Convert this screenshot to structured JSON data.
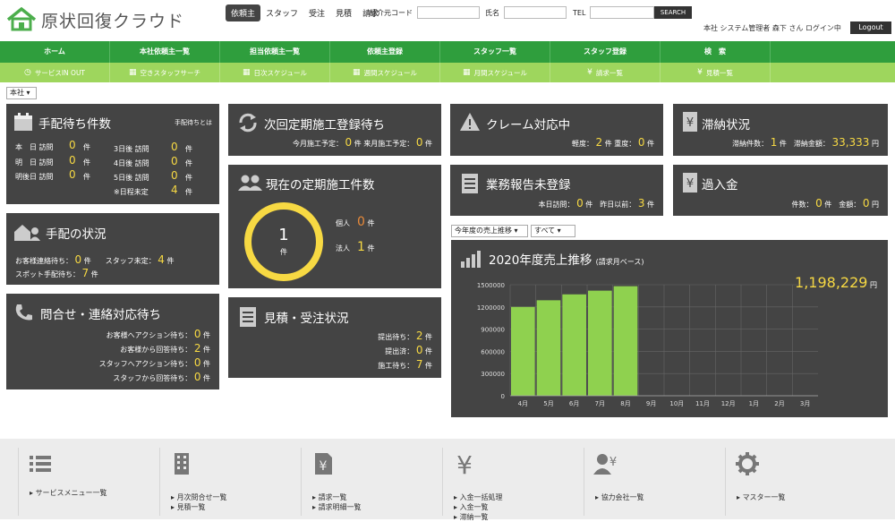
{
  "header": {
    "logo_text": "原状回復クラウド",
    "tabs": [
      "依頼主",
      "スタッフ",
      "受注",
      "見積",
      "請求"
    ],
    "search_labels": {
      "code": "紹介元コード",
      "name": "氏名",
      "tel": "TEL"
    },
    "search_button": "SEARCH",
    "user_info": "本社 システム管理者 森下 さん ログイン中",
    "logout": "Logout"
  },
  "nav_main": [
    "ホーム",
    "本社依頼主一覧",
    "担当依頼主一覧",
    "依頼主登録",
    "スタッフ一覧",
    "スタッフ登録",
    "検　索"
  ],
  "nav_sub": [
    {
      "label": "サービスIN OUT",
      "icon": "clock-icon"
    },
    {
      "label": "空きスタッフサーチ",
      "icon": "calendar-icon"
    },
    {
      "label": "日次スケジュール",
      "icon": "calendar-icon"
    },
    {
      "label": "週間スケジュール",
      "icon": "calendar-icon"
    },
    {
      "label": "月間スケジュール",
      "icon": "calendar-icon"
    },
    {
      "label": "請求一覧",
      "icon": "yen-icon"
    },
    {
      "label": "見積一覧",
      "icon": "yen-icon"
    }
  ],
  "branch_select": "本社",
  "tehai_wait": {
    "title": "手配待ち件数",
    "link": "手配待ちとは",
    "rows": [
      {
        "label": "本　日 訪問",
        "value": "0",
        "unit": "件"
      },
      {
        "label": "明　日 訪問",
        "value": "0",
        "unit": "件"
      },
      {
        "label": "明後日 訪問",
        "value": "0",
        "unit": "件"
      },
      {
        "label": "3日後 訪問",
        "value": "0",
        "unit": "件"
      },
      {
        "label": "4日後 訪問",
        "value": "0",
        "unit": "件"
      },
      {
        "label": "5日後 訪問",
        "value": "0",
        "unit": "件"
      },
      {
        "label": "※日程未定",
        "value": "4",
        "unit": "件"
      }
    ]
  },
  "tehai_status": {
    "title": "手配の状況",
    "l1": "お客様連絡待ち：",
    "v1": "0",
    "l2": "スタッフ未定：",
    "v2": "4",
    "l3": "スポット手配待ち：",
    "v3": "7",
    "unit": "件"
  },
  "inquiry": {
    "title": "問合せ・連絡対応待ち",
    "rows": [
      {
        "label": "お客様へアクション待ち：",
        "value": "0"
      },
      {
        "label": "お客様から回答待ち：",
        "value": "2"
      },
      {
        "label": "スタッフへアクション待ち：",
        "value": "0"
      },
      {
        "label": "スタッフから回答待ち：",
        "value": "0"
      }
    ],
    "unit": "件"
  },
  "next_reg": {
    "title": "次回定期施工登録待ち",
    "l1": "今月施工予定：",
    "v1": "0",
    "l2": "件 来月施工予定：",
    "v2": "0",
    "unit": "件"
  },
  "regular": {
    "title": "現在の定期施工件数",
    "total": "1",
    "total_unit": "件",
    "personal_label": "個人",
    "personal": "0",
    "corp_label": "法人",
    "corp": "1",
    "unit": "件"
  },
  "estimate": {
    "title": "見積・受注状況",
    "rows": [
      {
        "label": "提出待ち：",
        "value": "2"
      },
      {
        "label": "提出済：",
        "value": "0"
      },
      {
        "label": "施工待ち：",
        "value": "7"
      }
    ],
    "unit": "件"
  },
  "claim": {
    "title": "クレーム対応中",
    "l1": "軽度：",
    "v1": "2",
    "l2": "件 重度：",
    "v2": "0",
    "unit": "件"
  },
  "overdue": {
    "title": "滞納状況",
    "l1": "滞納件数：",
    "v1": "1",
    "l2": "件　滞納金額：",
    "v2": "33,333",
    "unit": "円"
  },
  "report": {
    "title": "業務報告未登録",
    "l1": "本日訪問：",
    "v1": "0",
    "l2": "件　昨日以前：",
    "v2": "3",
    "unit": "件"
  },
  "overpay": {
    "title": "過入金",
    "l1": "件数：",
    "v1": "0",
    "l2": "件　金額：",
    "v2": "0",
    "unit": "円"
  },
  "sales_selects": {
    "period": "今年度の売上推移",
    "scope": "すべて"
  },
  "sales": {
    "title": "2020年度売上推移",
    "subtitle": "(請求月ベース)",
    "total": "1,198,229",
    "total_unit": "円"
  },
  "chart_data": {
    "type": "bar",
    "title": "2020年度売上推移",
    "categories": [
      "4月",
      "5月",
      "6月",
      "7月",
      "8月",
      "9月",
      "10月",
      "11月",
      "12月",
      "1月",
      "2月",
      "3月"
    ],
    "values": [
      1200000,
      1290000,
      1370000,
      1420000,
      1480000,
      0,
      0,
      0,
      0,
      0,
      0,
      0
    ],
    "yticks": [
      0,
      300000,
      600000,
      900000,
      1200000,
      1500000
    ],
    "ylim": [
      0,
      1500000
    ],
    "bar_color": "#8fd14f"
  },
  "footer": [
    {
      "icon": "list-icon",
      "links": [
        "サービスメニュー一覧"
      ]
    },
    {
      "icon": "building-icon",
      "links": [
        "月次問合せ一覧",
        "見積一覧"
      ]
    },
    {
      "icon": "invoice-icon",
      "links": [
        "請求一覧",
        "請求明細一覧"
      ]
    },
    {
      "icon": "yen-icon",
      "links": [
        "入金一括処理",
        "入金一覧",
        "滞納一覧"
      ]
    },
    {
      "icon": "partner-icon",
      "links": [
        "協力会社一覧"
      ]
    },
    {
      "icon": "gear-icon",
      "links": [
        "マスター一覧"
      ]
    }
  ],
  "colors": {
    "green": "#2f9e3d",
    "lightgreen": "#9ed65d",
    "card": "#444444",
    "yellow": "#f7d943"
  }
}
